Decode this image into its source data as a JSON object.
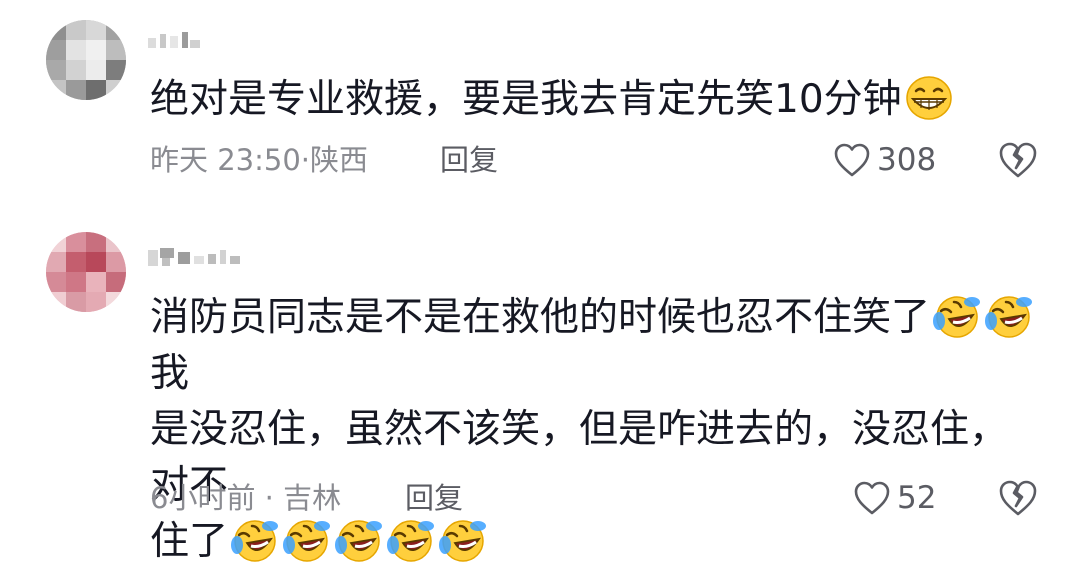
{
  "comments": [
    {
      "content_text": "绝对是专业救援，要是我去肯定先笑10分钟",
      "content_emoji": "grinning-emoji",
      "time": "昨天 23:50",
      "sep": "·",
      "location": "陕西",
      "reply_label": "回复",
      "likes": "308"
    },
    {
      "content_line1": "消防员同志是不是在救他的时候也忍不住笑了",
      "content_line1_after": "我",
      "content_line2": "是没忍住，虽然不该笑，但是咋进去的，没忍住，对不",
      "content_line3": "住了",
      "content_emoji": "rolling-laughing-emoji",
      "time": "6小时前",
      "sep": "·",
      "location": "吉林",
      "reply_label": "回复",
      "likes": "52"
    }
  ],
  "colors": {
    "text": "#161823",
    "meta": "#8a8b91",
    "icon": "#5b5c63"
  }
}
